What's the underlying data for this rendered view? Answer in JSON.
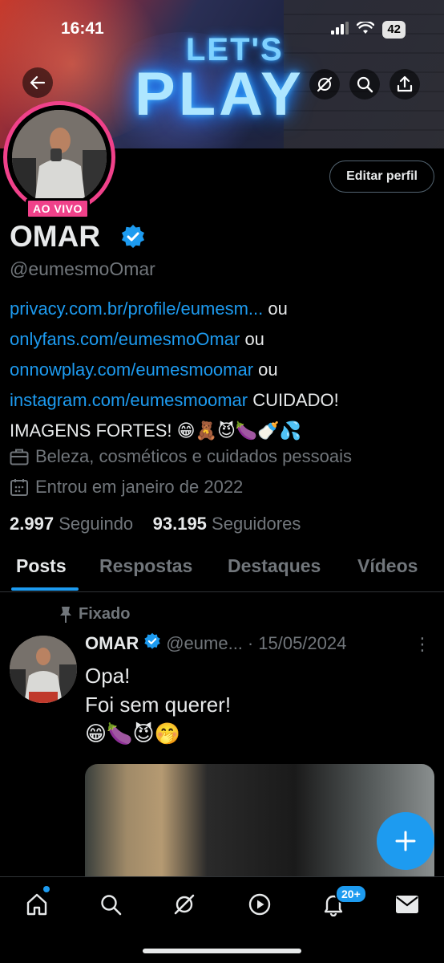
{
  "status_bar": {
    "time": "16:41",
    "battery": "42"
  },
  "banner": {
    "line1": "LET'S",
    "line2": "PLAY"
  },
  "profile": {
    "live_label": "AO VIVO",
    "edit_label": "Editar perfil",
    "name": "OMAR",
    "handle": "@eumesmoOmar",
    "bio": {
      "link1": "privacy.com.br/profile/eumesm...",
      "sep1": " ou",
      "link2": "onlyfans.com/eumesmoOmar",
      "sep2": " ou",
      "link3": "onnowplay.com/eumesmoomar",
      "sep3": " ou",
      "link4": "instagram.com/eumesmoomar",
      "text_after": " CUIDADO!",
      "line_last": "IMAGENS FORTES! 😁🧸😈🍆🍼💦"
    },
    "category": "Beleza, cosméticos e cuidados pessoais",
    "joined": "Entrou em janeiro de 2022",
    "following_count": "2.997",
    "following_label": "Seguindo",
    "followers_count": "93.195",
    "followers_label": "Seguidores"
  },
  "tabs": [
    {
      "label": "Posts"
    },
    {
      "label": "Respostas"
    },
    {
      "label": "Destaques"
    },
    {
      "label": "Vídeos"
    }
  ],
  "pinned_post": {
    "pinned_label": "Fixado",
    "author": "OMAR",
    "handle": "@eume...",
    "separator": "·",
    "date": "15/05/2024",
    "more": "⋮",
    "text_line1": "Opa!",
    "text_line2": "Foi sem querer!",
    "emojis": "😁🍆😈🤭"
  },
  "bottom_nav": {
    "notif_badge": "20+"
  },
  "colors": {
    "accent": "#1d9bf0",
    "live": "#f0418a",
    "muted": "#71767b"
  }
}
